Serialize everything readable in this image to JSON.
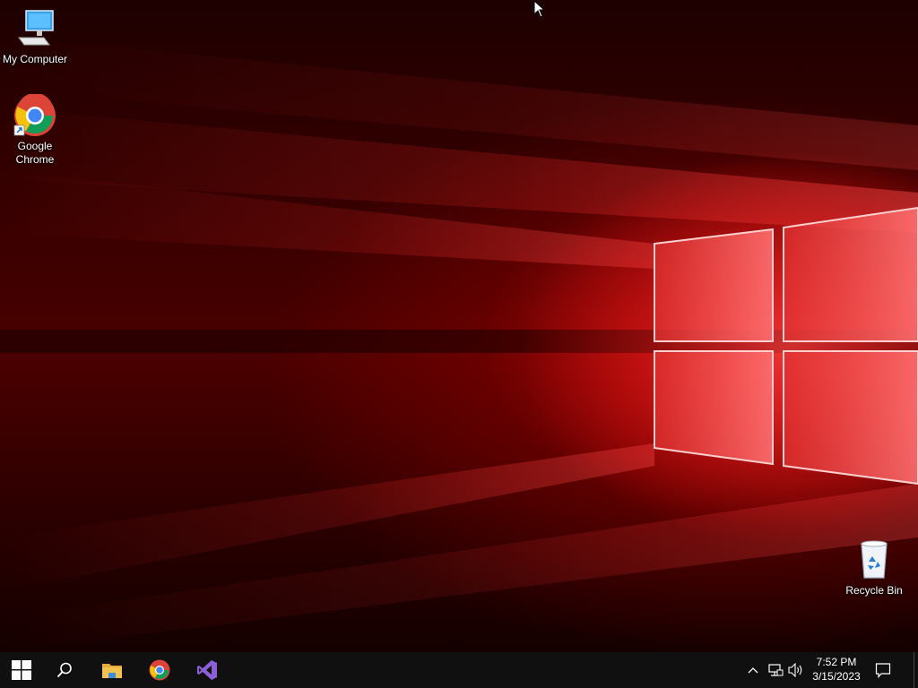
{
  "desktop": {
    "icons": [
      {
        "label": "My Computer",
        "icon": "computer-icon"
      },
      {
        "label": "Google\nChrome",
        "icon": "chrome-icon"
      },
      {
        "label": "Recycle Bin",
        "icon": "recycle-bin-icon"
      }
    ],
    "wallpaper": "windows-10-red-light-wallpaper"
  },
  "taskbar": {
    "start_icon": "windows-logo-icon",
    "search_icon": "search-icon",
    "pinned": [
      {
        "name": "File Explorer",
        "icon": "folder-icon"
      },
      {
        "name": "Google Chrome",
        "icon": "chrome-icon"
      },
      {
        "name": "Visual Studio",
        "icon": "visual-studio-icon"
      }
    ],
    "tray": {
      "chevron_icon": "chevron-up-icon",
      "network_icon": "network-icon",
      "volume_icon": "volume-icon",
      "notifications_icon": "notification-icon"
    },
    "clock": {
      "time": "7:52 PM",
      "date": "3/15/2023"
    }
  },
  "colors": {
    "taskbar_bg": "#101010",
    "wallpaper_accent": "#ff2020",
    "wallpaper_dark": "#1e0000",
    "visual_studio": "#8b5fd6",
    "folder": "#f2c14e"
  }
}
